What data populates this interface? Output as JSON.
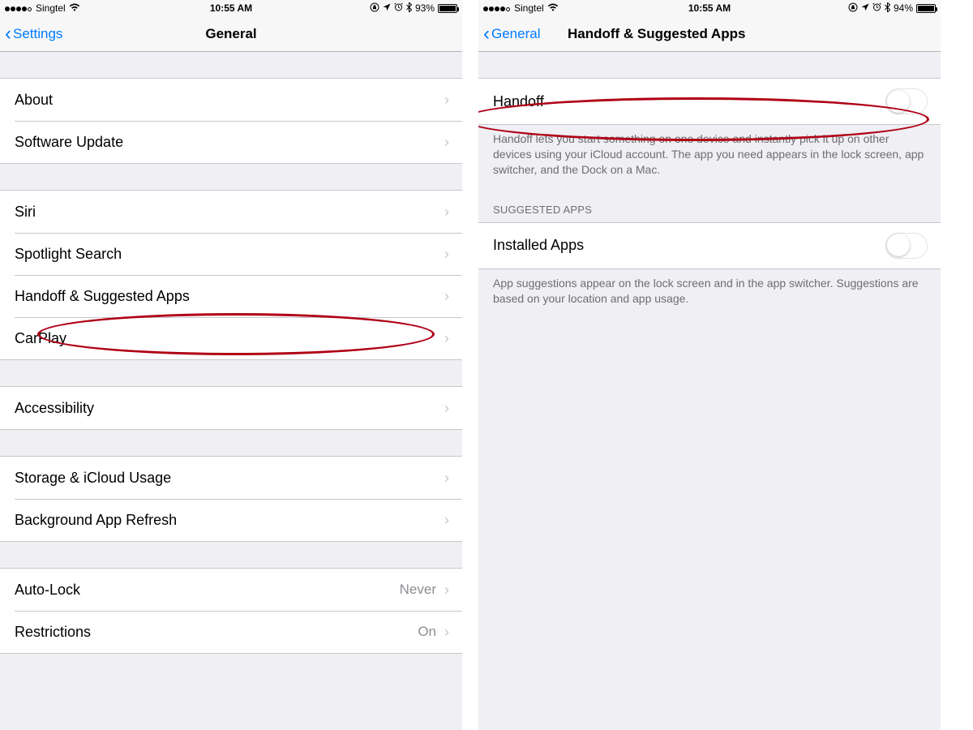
{
  "left": {
    "status": {
      "carrier": "Singtel",
      "time": "10:55 AM",
      "battery_pct": "93%"
    },
    "nav": {
      "back": "Settings",
      "title": "General"
    },
    "rows": {
      "about": "About",
      "software_update": "Software Update",
      "siri": "Siri",
      "spotlight": "Spotlight Search",
      "handoff": "Handoff & Suggested Apps",
      "carplay": "CarPlay",
      "accessibility": "Accessibility",
      "storage": "Storage & iCloud Usage",
      "bg_refresh": "Background App Refresh",
      "autolock": "Auto-Lock",
      "autolock_value": "Never",
      "restrictions": "Restrictions",
      "restrictions_value": "On"
    }
  },
  "right": {
    "status": {
      "carrier": "Singtel",
      "time": "10:55 AM",
      "battery_pct": "94%"
    },
    "nav": {
      "back": "General",
      "title": "Handoff & Suggested Apps"
    },
    "handoff_label": "Handoff",
    "handoff_footer": "Handoff lets you start something on one device and instantly pick it up on other devices using your iCloud account. The app you need appears in the lock screen, app switcher, and the Dock on a Mac.",
    "suggested_header": "SUGGESTED APPS",
    "installed_apps_label": "Installed Apps",
    "suggested_footer": "App suggestions appear on the lock screen and in the app switcher. Suggestions are based on your location and app usage."
  }
}
